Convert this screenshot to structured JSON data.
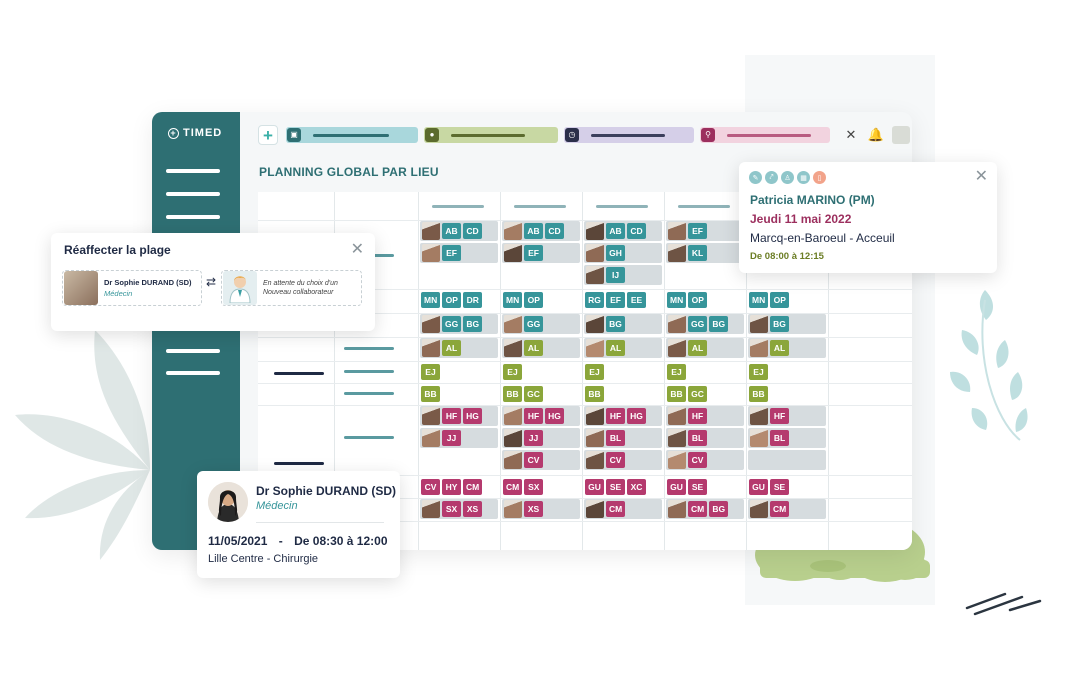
{
  "app": {
    "logo_text": "TIMED",
    "page_title": "PLANNING GLOBAL PAR LIEU",
    "colors": {
      "sidebar": "#2e6f73",
      "teal_badge": "#36959a",
      "green_badge": "#8ba63a",
      "pink_badge": "#b53a6e",
      "filter_teal": "#a9d7dc",
      "filter_green": "#c8d8a3",
      "filter_purple": "#d5cfe8",
      "filter_pink": "#f2d3df"
    },
    "toolbar": {
      "add_icon": "plus-icon",
      "filters": [
        {
          "name": "filter-cube",
          "icon": "cube-icon"
        },
        {
          "name": "filter-person",
          "icon": "person-icon"
        },
        {
          "name": "filter-clock",
          "icon": "clock-icon"
        },
        {
          "name": "filter-location",
          "icon": "location-pin-icon"
        }
      ],
      "right_icons": [
        "tools-icon",
        "bell-icon",
        "user-avatar"
      ]
    }
  },
  "planning": {
    "rows": [
      {
        "cells": [
          [
            {
              "photo": true,
              "badges": [
                "AB",
                "CD"
              ],
              "color": "teal"
            },
            {
              "photo": true,
              "badges": [
                "EF"
              ],
              "color": "teal"
            },
            null
          ],
          [
            {
              "photo": true,
              "badges": [
                "AB",
                "CD"
              ],
              "color": "teal"
            },
            {
              "photo": true,
              "badges": [
                "EF"
              ],
              "color": "teal"
            },
            null
          ],
          [
            {
              "photo": true,
              "badges": [
                "AB",
                "CD"
              ],
              "color": "teal"
            },
            {
              "photo": true,
              "badges": [
                "GH"
              ],
              "color": "teal"
            },
            {
              "photo": true,
              "badges": [
                "IJ"
              ],
              "color": "teal"
            }
          ],
          [
            {
              "photo": true,
              "badges": [
                "EF"
              ],
              "color": "teal"
            },
            {
              "photo": true,
              "badges": [
                "KL"
              ],
              "color": "teal"
            },
            null
          ]
        ]
      },
      {
        "cells": [
          [
            {
              "photo": false,
              "badges": [
                "MN",
                "OP",
                "DR"
              ],
              "color": "teal"
            }
          ],
          [
            {
              "photo": false,
              "badges": [
                "MN",
                "OP"
              ],
              "color": "teal"
            }
          ],
          [
            {
              "photo": false,
              "badges": [
                "RG",
                "EF",
                "EE"
              ],
              "color": "teal"
            }
          ],
          [
            {
              "photo": false,
              "badges": [
                "MN",
                "OP"
              ],
              "color": "teal"
            }
          ],
          [
            {
              "photo": false,
              "badges": [
                "MN",
                "OP"
              ],
              "color": "teal"
            }
          ]
        ]
      },
      {
        "cells": [
          [
            {
              "photo": true,
              "badges": [
                "GG",
                "BG"
              ],
              "color": "teal"
            }
          ],
          [
            {
              "photo": true,
              "badges": [
                "GG"
              ],
              "color": "teal"
            }
          ],
          [
            {
              "photo": true,
              "badges": [
                "BG"
              ],
              "color": "teal"
            }
          ],
          [
            {
              "photo": true,
              "badges": [
                "GG",
                "BG"
              ],
              "color": "teal"
            }
          ],
          [
            {
              "photo": true,
              "badges": [
                "BG"
              ],
              "color": "teal"
            }
          ]
        ]
      },
      {
        "cells": [
          [
            {
              "photo": true,
              "badges": [
                "AL"
              ],
              "color": "green"
            }
          ],
          [
            {
              "photo": true,
              "badges": [
                "AL"
              ],
              "color": "green"
            }
          ],
          [
            {
              "photo": true,
              "badges": [
                "AL"
              ],
              "color": "green"
            }
          ],
          [
            {
              "photo": true,
              "badges": [
                "AL"
              ],
              "color": "green"
            }
          ],
          [
            {
              "photo": true,
              "badges": [
                "AL"
              ],
              "color": "green"
            }
          ]
        ]
      },
      {
        "cells": [
          [
            {
              "photo": false,
              "badges": [
                "EJ"
              ],
              "color": "green"
            }
          ],
          [
            {
              "photo": false,
              "badges": [
                "EJ"
              ],
              "color": "green"
            }
          ],
          [
            {
              "photo": false,
              "badges": [
                "EJ"
              ],
              "color": "green"
            }
          ],
          [
            {
              "photo": false,
              "badges": [
                "EJ"
              ],
              "color": "green"
            }
          ],
          [
            {
              "photo": false,
              "badges": [
                "EJ"
              ],
              "color": "green"
            }
          ]
        ]
      },
      {
        "cells": [
          [
            {
              "photo": false,
              "badges": [
                "BB"
              ],
              "color": "green"
            }
          ],
          [
            {
              "photo": false,
              "badges": [
                "BB",
                "GC"
              ],
              "color": "green"
            }
          ],
          [
            {
              "photo": false,
              "badges": [
                "BB"
              ],
              "color": "green"
            }
          ],
          [
            {
              "photo": false,
              "badges": [
                "BB",
                "GC"
              ],
              "color": "green"
            }
          ],
          [
            {
              "photo": false,
              "badges": [
                "BB"
              ],
              "color": "green"
            }
          ]
        ]
      },
      {
        "cells": [
          [
            {
              "photo": true,
              "badges": [
                "HF",
                "HG"
              ],
              "color": "pink"
            },
            {
              "photo": true,
              "badges": [
                "JJ"
              ],
              "color": "pink"
            },
            null
          ],
          [
            {
              "photo": true,
              "badges": [
                "HF",
                "HG"
              ],
              "color": "pink"
            },
            {
              "photo": true,
              "badges": [
                "JJ"
              ],
              "color": "pink"
            },
            {
              "photo": true,
              "badges": [
                "CV"
              ],
              "color": "pink"
            }
          ],
          [
            {
              "photo": true,
              "badges": [
                "HF",
                "HG"
              ],
              "color": "pink"
            },
            {
              "photo": true,
              "badges": [
                "BL"
              ],
              "color": "pink"
            },
            {
              "photo": true,
              "badges": [
                "CV"
              ],
              "color": "pink"
            }
          ],
          [
            {
              "photo": true,
              "badges": [
                "HF"
              ],
              "color": "pink"
            },
            {
              "photo": true,
              "badges": [
                "BL"
              ],
              "color": "pink"
            },
            {
              "photo": true,
              "badges": [
                "CV"
              ],
              "color": "pink"
            }
          ],
          [
            {
              "photo": true,
              "badges": [
                "HF"
              ],
              "color": "pink"
            },
            {
              "photo": true,
              "badges": [
                "BL"
              ],
              "color": "pink"
            },
            {
              "empty": true
            }
          ]
        ]
      },
      {
        "cells": [
          [
            {
              "photo": false,
              "badges": [
                "CV",
                "HY",
                "CM"
              ],
              "color": "pink"
            }
          ],
          [
            {
              "photo": false,
              "badges": [
                "CM",
                "SX"
              ],
              "color": "pink"
            }
          ],
          [
            {
              "photo": false,
              "badges": [
                "GU",
                "SE",
                "XC"
              ],
              "color": "pink"
            }
          ],
          [
            {
              "photo": false,
              "badges": [
                "GU",
                "SE"
              ],
              "color": "pink"
            }
          ],
          [
            {
              "photo": false,
              "badges": [
                "GU",
                "SE"
              ],
              "color": "pink"
            }
          ]
        ]
      },
      {
        "cells": [
          [
            {
              "photo": true,
              "badges": [
                "SX",
                "XS"
              ],
              "color": "pink"
            }
          ],
          [
            {
              "photo": true,
              "badges": [
                "XS"
              ],
              "color": "pink"
            }
          ],
          [
            {
              "photo": true,
              "badges": [
                "CM"
              ],
              "color": "pink"
            }
          ],
          [
            {
              "photo": true,
              "badges": [
                "CM",
                "BG"
              ],
              "color": "pink"
            }
          ],
          [
            {
              "photo": true,
              "badges": [
                "CM"
              ],
              "color": "pink"
            }
          ]
        ]
      }
    ]
  },
  "reassign": {
    "title": "Réaffecter la plage",
    "close_icon": "close-icon",
    "current_name": "Dr Sophie DURAND (SD)",
    "current_role": "Médecin",
    "swap_icon": "swap-arrows-icon",
    "pending_line1": "En attente du choix d'un",
    "pending_line2": "Nouveau collaborateur"
  },
  "popup": {
    "action_icons": [
      "pencil-icon",
      "link-icon",
      "user-icon",
      "calendar-icon",
      "trash-icon"
    ],
    "close_icon": "close-icon",
    "name": "Patricia MARINO (PM)",
    "date": "Jeudi 11 mai 2022",
    "location": "Marcq-en-Baroeul - Acceuil",
    "hours": "De 08:00 à 12:15"
  },
  "doctor_card": {
    "name": "Dr Sophie DURAND (SD)",
    "role": "Médecin",
    "date": "11/05/2021",
    "separator": "-",
    "hours": "De 08:30 à 12:00",
    "location": "Lille Centre - Chirurgie"
  }
}
